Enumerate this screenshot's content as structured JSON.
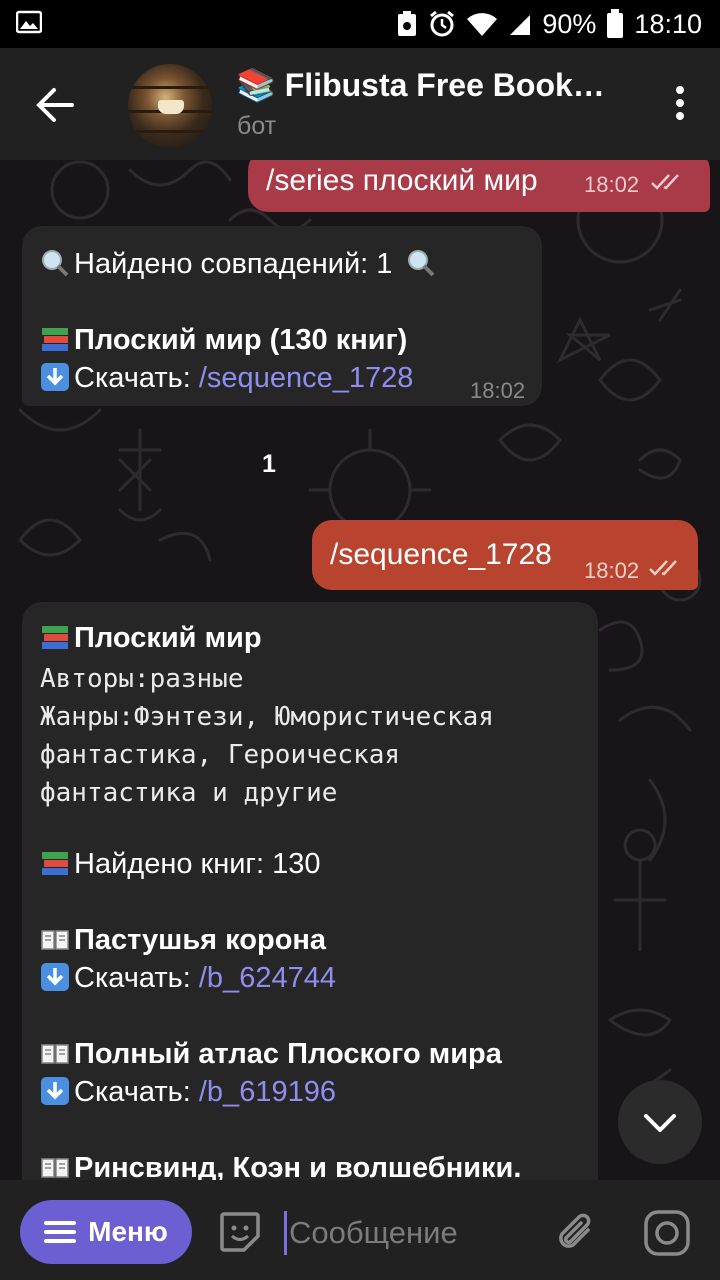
{
  "status_bar": {
    "battery": "90%",
    "time": "18:10"
  },
  "header": {
    "title": "📚 Flibusta Free Book…",
    "subtitle": "бот"
  },
  "messages": [
    {
      "type": "outgoing",
      "text": "/series плоский мир",
      "time": "18:02"
    },
    {
      "type": "incoming",
      "lines": {
        "found": "Найдено совпадений: 1",
        "series": "Плоский мир (130 книг)",
        "download_label": "Скачать: ",
        "download_link": "/sequence_1728"
      },
      "time": "18:02"
    },
    {
      "type": "date_chip",
      "text": "1"
    },
    {
      "type": "outgoing",
      "text": "/sequence_1728",
      "time": "18:02"
    },
    {
      "type": "incoming",
      "lines": {
        "series_title": "Плоский мир",
        "authors": "Авторы:разные",
        "genres_1": "Жанры:Фэнтези, Юмористическая",
        "genres_2": "фантастика, Героическая",
        "genres_3": "фантастика и другие",
        "found_books": "Найдено книг: 130",
        "book1_title": "Пастушья корона",
        "book1_download": "Скачать: ",
        "book1_link": "/b_624744",
        "book2_title": "Полный атлас Плоского мира",
        "book2_download": "Скачать: ",
        "book2_link": "/b_619196",
        "book3_title": "Ринсвинд, Коэн и волшебники."
      }
    }
  ],
  "input_bar": {
    "menu_label": "Меню",
    "placeholder": "Сообщение"
  },
  "colors": {
    "outgoing_bubble_1": "#a93a48",
    "outgoing_bubble_2": "#b8442f",
    "incoming_bubble": "#262626",
    "link": "#8f8df0",
    "accent": "#6b5fd1",
    "header_bg": "#212121"
  },
  "icons": [
    "back-arrow-icon",
    "more-vert-icon",
    "search-icon",
    "books-icon",
    "download-icon",
    "open-book-icon",
    "chevron-down-icon",
    "sticker-icon",
    "attach-icon",
    "camera-icon",
    "menu-lines-icon",
    "double-check-icon"
  ]
}
